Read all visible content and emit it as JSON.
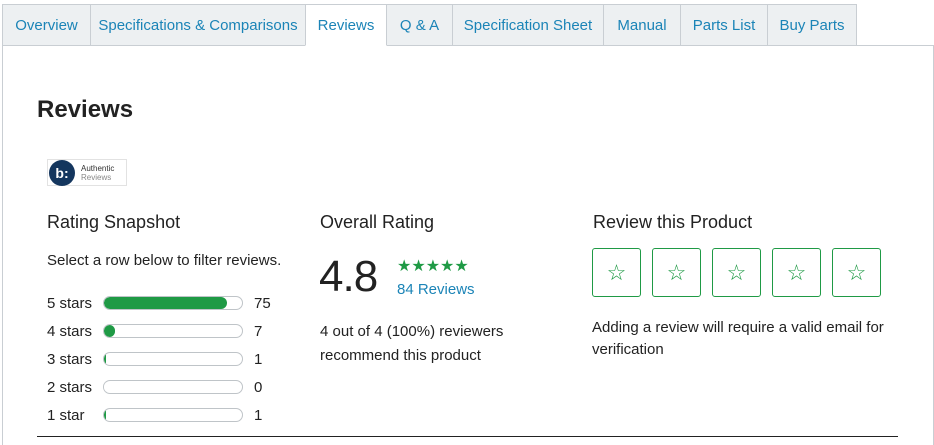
{
  "tabs": [
    {
      "label": "Overview",
      "active": false
    },
    {
      "label": "Specifications & Comparisons",
      "active": false
    },
    {
      "label": "Reviews",
      "active": true
    },
    {
      "label": "Q & A",
      "active": false
    },
    {
      "label": "Specification Sheet",
      "active": false
    },
    {
      "label": "Manual",
      "active": false
    },
    {
      "label": "Parts List",
      "active": false
    },
    {
      "label": "Buy Parts",
      "active": false
    }
  ],
  "page": {
    "title": "Reviews"
  },
  "badge": {
    "logo": "b:",
    "line1": "Authentic",
    "line2": "Reviews"
  },
  "snapshot": {
    "heading": "Rating Snapshot",
    "hint": "Select a row below to filter reviews.",
    "rows": [
      {
        "label": "5 stars",
        "count": "75",
        "fraction": 0.89
      },
      {
        "label": "4 stars",
        "count": "7",
        "fraction": 0.08
      },
      {
        "label": "3 stars",
        "count": "1",
        "fraction": 0.01
      },
      {
        "label": "2 stars",
        "count": "0",
        "fraction": 0.0
      },
      {
        "label": "1 star",
        "count": "1",
        "fraction": 0.01
      }
    ]
  },
  "overall": {
    "heading": "Overall Rating",
    "score": "4.8",
    "stars": "★★★★★",
    "reviews_link": "84 Reviews",
    "recommend": "4 out of 4 (100%) reviewers recommend this product"
  },
  "review_product": {
    "heading": "Review this Product",
    "star_glyph": "☆",
    "notice": "Adding a review will require a valid email for verification"
  },
  "colors": {
    "accent_green": "#1f9a45",
    "link_blue": "#1b84b7",
    "tab_bg": "#edf0f2"
  }
}
